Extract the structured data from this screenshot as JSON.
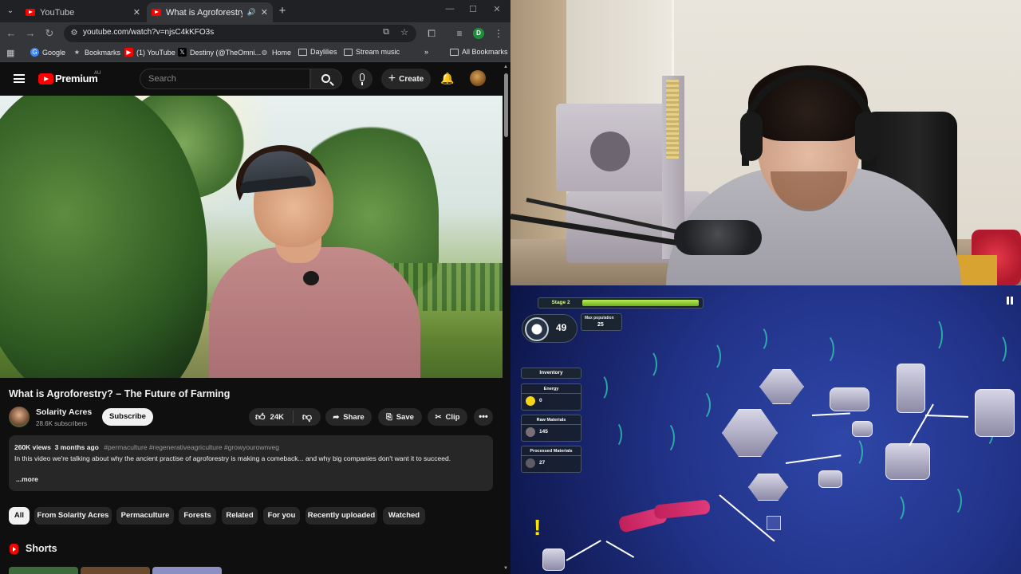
{
  "browser": {
    "tabs": [
      {
        "title": "YouTube",
        "active": false
      },
      {
        "title": "What is Agroforestry? – The",
        "active": true
      }
    ],
    "url": "youtube.com/watch?v=njsC4kKFO3s",
    "profile_initial": "D",
    "bookmarks": [
      "Google",
      "Bookmarks",
      "(1) YouTube",
      "Destiny (@TheOmni...",
      "Home",
      "Daylilies",
      "Stream music"
    ],
    "all_bookmarks": "All Bookmarks",
    "more_bookmarks": "»"
  },
  "youtube": {
    "brand": "Premium",
    "region": "AU",
    "search_placeholder": "Search",
    "create_label": "Create",
    "video": {
      "title": "What is Agroforestry? – The Future of Farming",
      "channel": "Solarity Acres",
      "subscribers": "28.6K subscribers",
      "subscribe_label": "Subscribe",
      "likes": "24K",
      "share_label": "Share",
      "save_label": "Save",
      "clip_label": "Clip",
      "more_label": "•••",
      "views": "260K views",
      "age": "3 months ago",
      "tags": "#permaculture #regenerativeagriculture #growyourownveg",
      "description": "In this video we're talking about why the ancient practise of agroforestry is making a comeback... and why big companies don't want it to succeed.",
      "more_link": "...more"
    },
    "chips": [
      "All",
      "From Solarity Acres",
      "Permaculture",
      "Forests",
      "Related",
      "For you",
      "Recently uploaded",
      "Watched"
    ],
    "shorts_title": "Shorts"
  },
  "game": {
    "stage_label": "Stage 2",
    "stage_progress": 1.0,
    "population": "49",
    "max_population_label": "Max population",
    "max_population": "25",
    "inventory_title": "Inventory",
    "inventory": [
      {
        "label": "Energy",
        "value": "0",
        "color": "#f5d514"
      },
      {
        "label": "Raw Materials",
        "value": "145",
        "color": "#7a6f78"
      },
      {
        "label": "Processed Materials",
        "value": "27",
        "color": "#5e5a66"
      }
    ],
    "alert": "!"
  },
  "colors": {
    "youtube_red": "#ff0000",
    "yt_background": "#0f0f0f",
    "chip_bg": "#272727",
    "stage_fill": "#8fd12f",
    "game_bg": "#22338a"
  }
}
